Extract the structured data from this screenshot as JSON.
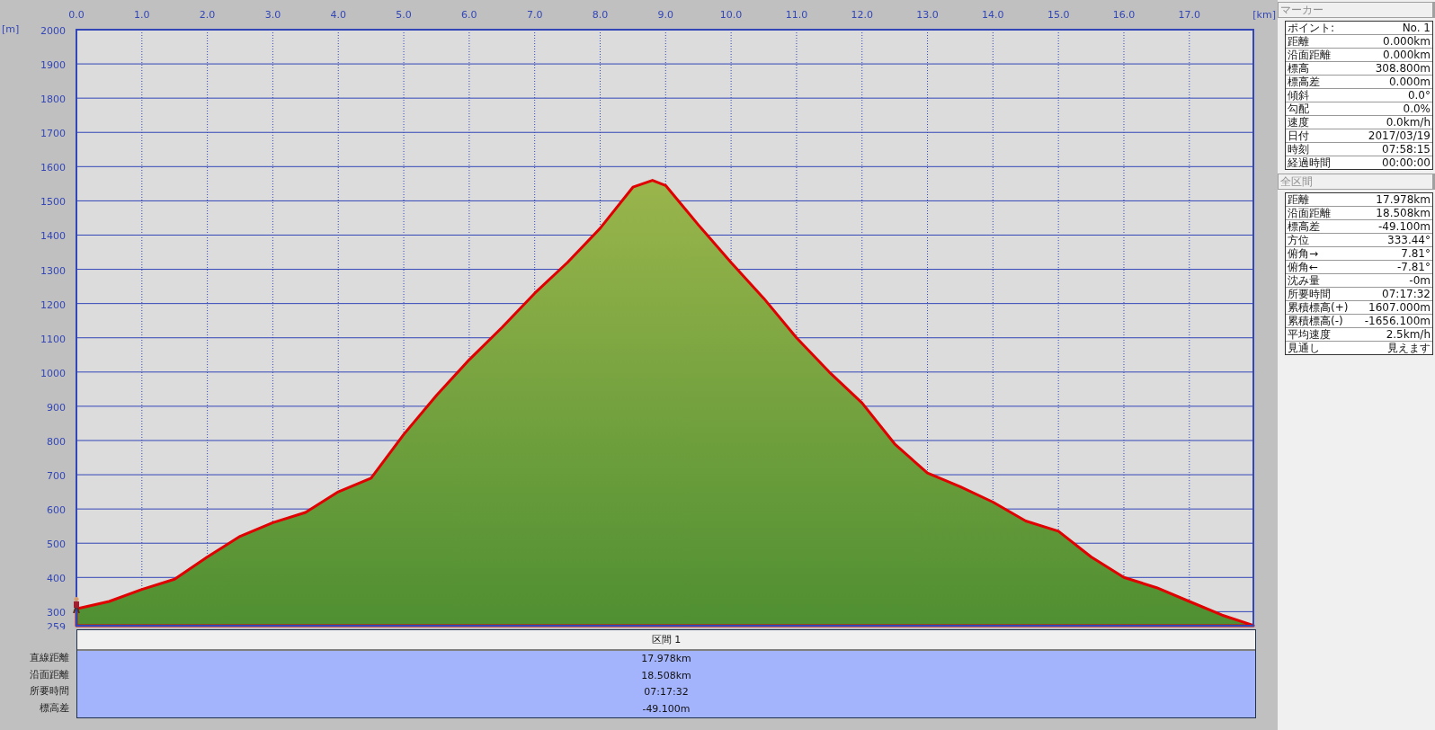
{
  "chart": {
    "chart_data": {
      "type": "area",
      "xlabel": "[km]",
      "ylabel": "[m]",
      "grid": true,
      "x": [
        0,
        0.5,
        1,
        1.5,
        2,
        2.5,
        3,
        3.5,
        4,
        4.5,
        5,
        5.5,
        6,
        6.5,
        7,
        7.5,
        8,
        8.5,
        8.8,
        9,
        9.5,
        10,
        10.5,
        11,
        11.5,
        12,
        12.5,
        13,
        13.5,
        14,
        14.5,
        15,
        15.5,
        16,
        16.5,
        17,
        17.5,
        17.978
      ],
      "series": [
        {
          "color": "#e00000",
          "values": [
            308,
            330,
            365,
            395,
            460,
            520,
            560,
            590,
            650,
            690,
            818,
            932,
            1036,
            1130,
            1230,
            1320,
            1420,
            1540,
            1560,
            1545,
            1430,
            1320,
            1215,
            1100,
            1000,
            910,
            790,
            705,
            665,
            620,
            565,
            535,
            460,
            400,
            370,
            330,
            290,
            260
          ]
        }
      ],
      "xlim": [
        0,
        17.978
      ],
      "ylim": [
        259,
        2000
      ],
      "xticks": [
        {
          "value": 0,
          "label": "0.0"
        },
        {
          "value": 1,
          "label": "1.0"
        },
        {
          "value": 2,
          "label": "2.0"
        },
        {
          "value": 3,
          "label": "3.0"
        },
        {
          "value": 4,
          "label": "4.0"
        },
        {
          "value": 5,
          "label": "5.0"
        },
        {
          "value": 6,
          "label": "6.0"
        },
        {
          "value": 7,
          "label": "7.0"
        },
        {
          "value": 8,
          "label": "8.0"
        },
        {
          "value": 9,
          "label": "9.0"
        },
        {
          "value": 10,
          "label": "10.0"
        },
        {
          "value": 11,
          "label": "11.0"
        },
        {
          "value": 12,
          "label": "12.0"
        },
        {
          "value": 13,
          "label": "13.0"
        },
        {
          "value": 14,
          "label": "14.0"
        },
        {
          "value": 15,
          "label": "15.0"
        },
        {
          "value": 16,
          "label": "16.0"
        },
        {
          "value": 17,
          "label": "17.0"
        }
      ],
      "yticks": [
        259,
        300,
        400,
        500,
        600,
        700,
        800,
        900,
        1000,
        1100,
        1200,
        1300,
        1400,
        1500,
        1600,
        1700,
        1800,
        1900,
        2000
      ]
    }
  },
  "section_table": {
    "header": "区間 1",
    "rows": [
      {
        "label": "直線距離",
        "value": "17.978km"
      },
      {
        "label": "沿面距離",
        "value": "18.508km"
      },
      {
        "label": "所要時間",
        "value": "07:17:32"
      },
      {
        "label": "標高差",
        "value": "-49.100m"
      }
    ]
  },
  "marker_panel": {
    "title": "マーカー",
    "rows": [
      {
        "label": "ポイント:",
        "value": "No. 1"
      },
      {
        "label": "距離",
        "value": "0.000km"
      },
      {
        "label": "沿面距離",
        "value": "0.000km"
      },
      {
        "label": "標高",
        "value": "308.800m"
      },
      {
        "label": "標高差",
        "value": "0.000m"
      },
      {
        "label": "傾斜",
        "value": "0.0°"
      },
      {
        "label": "勾配",
        "value": "0.0%"
      },
      {
        "label": "速度",
        "value": "0.0km/h"
      },
      {
        "label": "日付",
        "value": "2017/03/19"
      },
      {
        "label": "時刻",
        "value": "07:58:15"
      },
      {
        "label": "経過時間",
        "value": "00:00:00"
      }
    ]
  },
  "total_panel": {
    "title": "全区間",
    "rows": [
      {
        "label": "距離",
        "value": "17.978km"
      },
      {
        "label": "沿面距離",
        "value": "18.508km"
      },
      {
        "label": "標高差",
        "value": "-49.100m"
      },
      {
        "label": "方位",
        "value": "333.44°"
      },
      {
        "label": "俯角→",
        "value": "7.81°"
      },
      {
        "label": "俯角←",
        "value": "-7.81°"
      },
      {
        "label": "沈み量",
        "value": "-0m"
      },
      {
        "label": "所要時間",
        "value": "07:17:32"
      },
      {
        "label": "累積標高(+)",
        "value": "1607.000m"
      },
      {
        "label": "累積標高(-)",
        "value": "-1656.100m"
      },
      {
        "label": "平均速度",
        "value": "2.5km/h"
      },
      {
        "label": "見通し",
        "value": "見えます"
      }
    ]
  }
}
